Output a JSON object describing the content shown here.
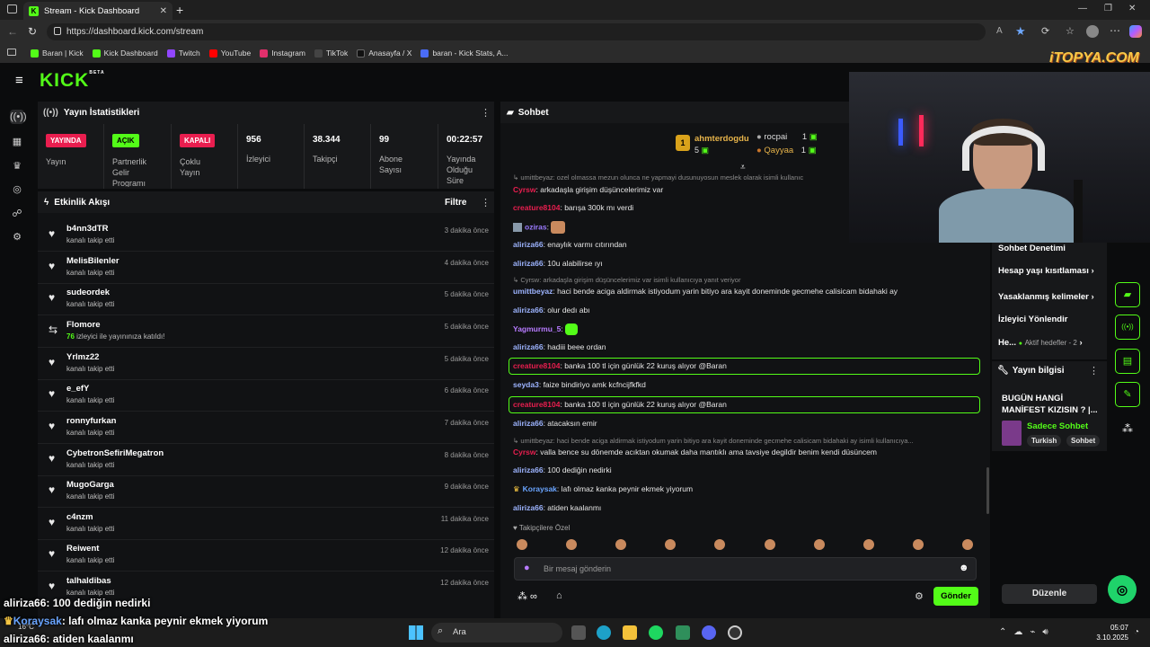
{
  "browser": {
    "tab_title": "Stream - Kick Dashboard",
    "url": "https://dashboard.kick.com/stream"
  },
  "bookmarks": [
    {
      "label": "Baran | Kick",
      "color": "#53fc18"
    },
    {
      "label": "Kick Dashboard",
      "color": "#53fc18"
    },
    {
      "label": "Twitch",
      "color": "#9146ff"
    },
    {
      "label": "YouTube",
      "color": "#ff0000"
    },
    {
      "label": "Instagram",
      "color": "#e1306c"
    },
    {
      "label": "TikTok",
      "color": "#222222"
    },
    {
      "label": "Anasayfa / X",
      "color": "#111111"
    },
    {
      "label": "baran - Kick Stats, A...",
      "color": "#4a6cf7"
    }
  ],
  "logo": "KICK",
  "logo_sup": "BETA",
  "stats": {
    "title": "Yayın İstatistikleri",
    "items": [
      {
        "badge": "YAYINDA",
        "badge_color": "#e91e4f",
        "label": "Yayın"
      },
      {
        "badge": "AÇIK",
        "badge_color": "#53fc18",
        "label": "Partnerlik Gelir Programı"
      },
      {
        "badge": "KAPALI",
        "badge_color": "#e91e4f",
        "label": "Çoklu Yayın"
      },
      {
        "value": "956",
        "label": "İzleyici"
      },
      {
        "value": "38.344",
        "label": "Takipçi"
      },
      {
        "value": "99",
        "label": "Abone Sayısı"
      },
      {
        "value": "00:22:57",
        "label": "Yayında Olduğu Süre"
      }
    ]
  },
  "activity": {
    "title": "Etkinlik Akışı",
    "filter": "Filtre",
    "items": [
      {
        "name": "b4nn3dTR",
        "sub": "kanalı takip etti",
        "time": "3 dakika önce"
      },
      {
        "name": "MelisBilenler",
        "sub": "kanalı takip etti",
        "time": "4 dakika önce"
      },
      {
        "name": "sudeordek",
        "sub": "kanalı takip etti",
        "time": "5 dakika önce"
      },
      {
        "name": "Flomore",
        "count": "76",
        "sub": "izleyici ile yayınınıza katıldı!",
        "time": "5 dakika önce"
      },
      {
        "name": "Yrlmz22",
        "sub": "kanalı takip etti",
        "time": "5 dakika önce"
      },
      {
        "name": "e_efY",
        "sub": "kanalı takip etti",
        "time": "6 dakika önce"
      },
      {
        "name": "ronnyfurkan",
        "sub": "kanalı takip etti",
        "time": "7 dakika önce"
      },
      {
        "name": "CybetronSefiriMegatron",
        "sub": "kanalı takip etti",
        "time": "8 dakika önce"
      },
      {
        "name": "MugoGarga",
        "sub": "kanalı takip etti",
        "time": "9 dakika önce"
      },
      {
        "name": "c4nzm",
        "sub": "kanalı takip etti",
        "time": "11 dakika önce"
      },
      {
        "name": "Reiwent",
        "sub": "kanalı takip etti",
        "time": "12 dakika önce"
      },
      {
        "name": "talhaldibas",
        "sub": "kanalı takip etti",
        "time": "12 dakika önce"
      }
    ]
  },
  "chat": {
    "title": "Sohbet",
    "leaders": {
      "first": "ahmterdogdu",
      "first_count": "5",
      "second": "rocpai",
      "second_count": "1",
      "third": "Qayyaa",
      "third_count": "1",
      "rank": "1"
    },
    "reply1": "umittbeyaz: ozel olmassa mezun olunca ne yapmayi dusunuyosun meslek olarak isimli kullanıc",
    "messages": [
      {
        "u": "Cyrsw",
        "c": "#e91e4f",
        "t": ": arkadaşla girişim düşüncelerimiz var"
      },
      {
        "u": "creature8104",
        "c": "#e91e4f",
        "t": ": barışa 300k mı verdi"
      },
      {
        "u": "oziras",
        "c": "#9b7bff",
        "t": ":"
      },
      {
        "u": "aliriza66",
        "c": "#9db4ff",
        "t": ": enaylık varmı cıtırından"
      },
      {
        "u": "aliriza66",
        "c": "#9db4ff",
        "t": ": 10u alabilirse ıyı"
      },
      {
        "u": "umittbeyaz",
        "c": "#9db4ff",
        "t": ": haci bende aciga aldirmak istiyodum yarin bitiyo ara kayit doneminde gecmehe calisicam bidahaki ay"
      },
      {
        "u": "aliriza66",
        "c": "#9db4ff",
        "t": ": olur dedı abı"
      },
      {
        "u": "Yagmurmu_5",
        "c": "#b77bff",
        "t": ":"
      },
      {
        "u": "aliriza66",
        "c": "#9db4ff",
        "t": ": hadiii beee ordan"
      },
      {
        "u": "creature8104",
        "c": "#e91e4f",
        "t": ": banka 100 tl için günlük 22 kuruş alıyor @Baran"
      },
      {
        "u": "seyda3",
        "c": "#9db4ff",
        "t": ": faize bindiriyo amk kcfncijfkfkd"
      },
      {
        "u": "creature8104",
        "c": "#e91e4f",
        "t": ": banka 100 tl için günlük 22 kuruş alıyor @Baran"
      },
      {
        "u": "aliriza66",
        "c": "#9db4ff",
        "t": ": atacaksın emir"
      },
      {
        "u": "Cyrsw",
        "c": "#e91e4f",
        "t": ": valla bence su dönemde acıktan okumak daha mantıklı ama tavsiye degildir benim kendi düsüncem"
      },
      {
        "u": "aliriza66",
        "c": "#9db4ff",
        "t": ": 100 dediğin nedirki"
      },
      {
        "u": "Koraysak",
        "c": "#6aa5ff",
        "t": ": lafı olmaz kanka peynir ekmek yiyorum"
      },
      {
        "u": "aliriza66",
        "c": "#9db4ff",
        "t": ": atiden kaalanmı"
      }
    ],
    "reply2": "Cyrsw: arkadaşla girişim düşüncelerimiz var isimli kullanıcıya yanıt veriyor",
    "reply3": "umittbeyaz: haci bende aciga aldirmak istiyodum yarin bitiyo ara kayit doneminde gecmehe calisicam bidahaki ay isimli kullanıcıya...",
    "followers_label": "Takipçilere Özel",
    "placeholder": "Bir mesaj gönderin",
    "send": "Gönder"
  },
  "right": {
    "links": [
      "Sohbet Denetimi",
      "Hesap yaşı kısıtlaması",
      "Yasaklanmış kelimeler",
      "İzleyici Yönlendir",
      "He..."
    ],
    "active_goals": "Aktif hedefler - 2",
    "info_title": "Yayın bilgisi",
    "stream_title": "BUGÜN HANGİ MANİFEST KIZISIN ? |...",
    "category": "Sadece Sohbet",
    "tags": [
      "Turkish",
      "Sohbet"
    ],
    "edit": "Düzenle"
  },
  "overlay": {
    "watermark": "iTOPYA.COM",
    "lines": [
      {
        "u": "aliriza66",
        "t": ": 100 dediğin nedirki"
      },
      {
        "u": "Koraysak",
        "t": ": lafı olmaz kanka peynir ekmek yiyorum"
      },
      {
        "u": "aliriza66",
        "t": ": atiden kaalanmı"
      }
    ]
  },
  "taskbar": {
    "search": "Ara",
    "temp": "16°C",
    "time": "05:07",
    "date": "3.10.2025"
  }
}
